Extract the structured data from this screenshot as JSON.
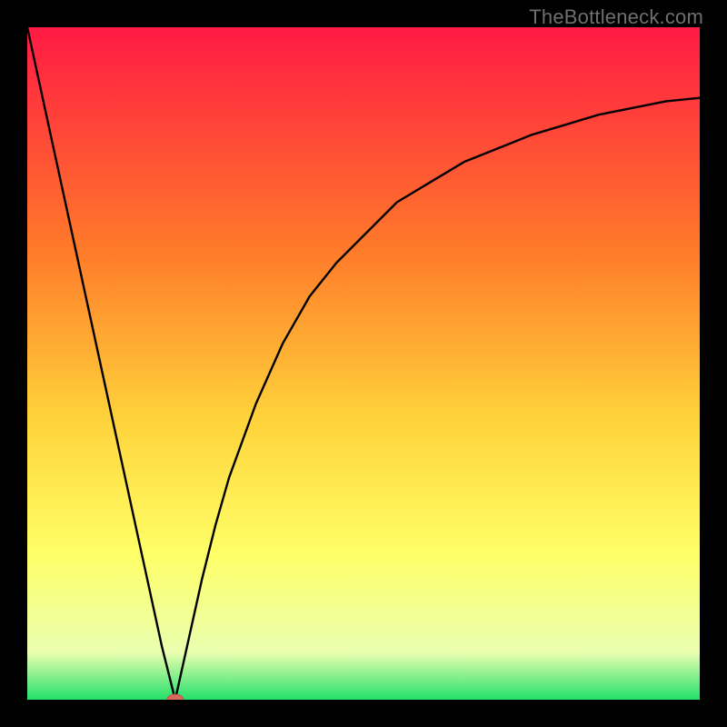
{
  "watermark": "TheBottleneck.com",
  "colors": {
    "gradient_top": "#ff1a44",
    "gradient_mid1": "#ff7a2a",
    "gradient_mid2": "#ffd23a",
    "gradient_mid3": "#ffff66",
    "gradient_bottom_pale": "#eaffb0",
    "gradient_bottom": "#22e06a",
    "curve": "#000000",
    "marker_fill": "#d9695f",
    "marker_stroke": "#c84f46",
    "frame": "#000000"
  },
  "chart_data": {
    "type": "line",
    "title": "",
    "xlabel": "",
    "ylabel": "",
    "xlim": [
      0,
      100
    ],
    "ylim": [
      0,
      100
    ],
    "grid": false,
    "legend": false,
    "series": [
      {
        "name": "bottleneck-curve",
        "x": [
          0,
          5,
          10,
          15,
          20,
          22,
          24,
          26,
          28,
          30,
          34,
          38,
          42,
          46,
          50,
          55,
          60,
          65,
          70,
          75,
          80,
          85,
          90,
          95,
          100
        ],
        "y": [
          100,
          77,
          54,
          31,
          8,
          0,
          9,
          18,
          26,
          33,
          44,
          53,
          60,
          65,
          69,
          74,
          77,
          80,
          82,
          84,
          85.5,
          87,
          88,
          89,
          89.5
        ]
      }
    ],
    "annotations": [
      {
        "name": "optimal-marker",
        "x": 22,
        "y": 0
      }
    ]
  }
}
